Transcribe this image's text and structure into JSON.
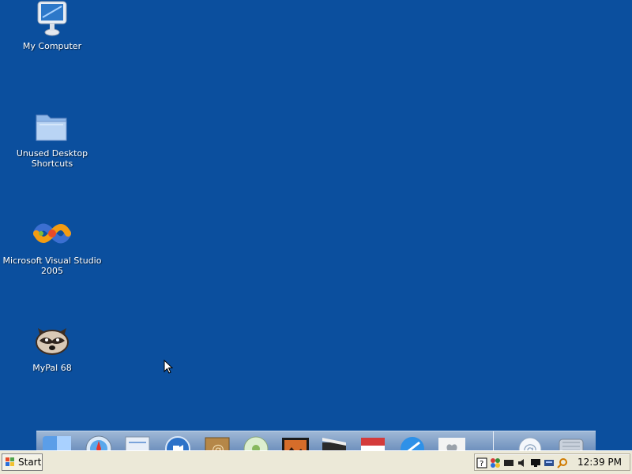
{
  "desktop": {
    "background": "#0b4f9e",
    "icons": [
      {
        "label": "My Computer",
        "icon": "monitor-icon"
      },
      {
        "label": "Unused Desktop Shortcuts",
        "icon": "folder-icon"
      },
      {
        "label": "Microsoft Visual Studio\n2005",
        "icon": "visual-studio-icon"
      },
      {
        "label": "MyPal 68",
        "icon": "raccoon-icon"
      }
    ]
  },
  "dock": {
    "items": [
      "finder-icon",
      "safari-icon",
      "mail-stamp-icon",
      "ichat-icon",
      "address-book-icon",
      "itunes-icon",
      "iphoto-icon",
      "imovie-icon",
      "ical-icon",
      "appstore-icon",
      "apple-icon",
      "email-at-icon",
      "trash-icon"
    ]
  },
  "taskbar": {
    "start_label": "Start",
    "clock": "12:39 PM",
    "tray_icons": [
      "help-icon",
      "network-icon",
      "display-icon",
      "volume-icon",
      "monitor-tray-icon",
      "keyboard-icon",
      "search-icon"
    ]
  }
}
